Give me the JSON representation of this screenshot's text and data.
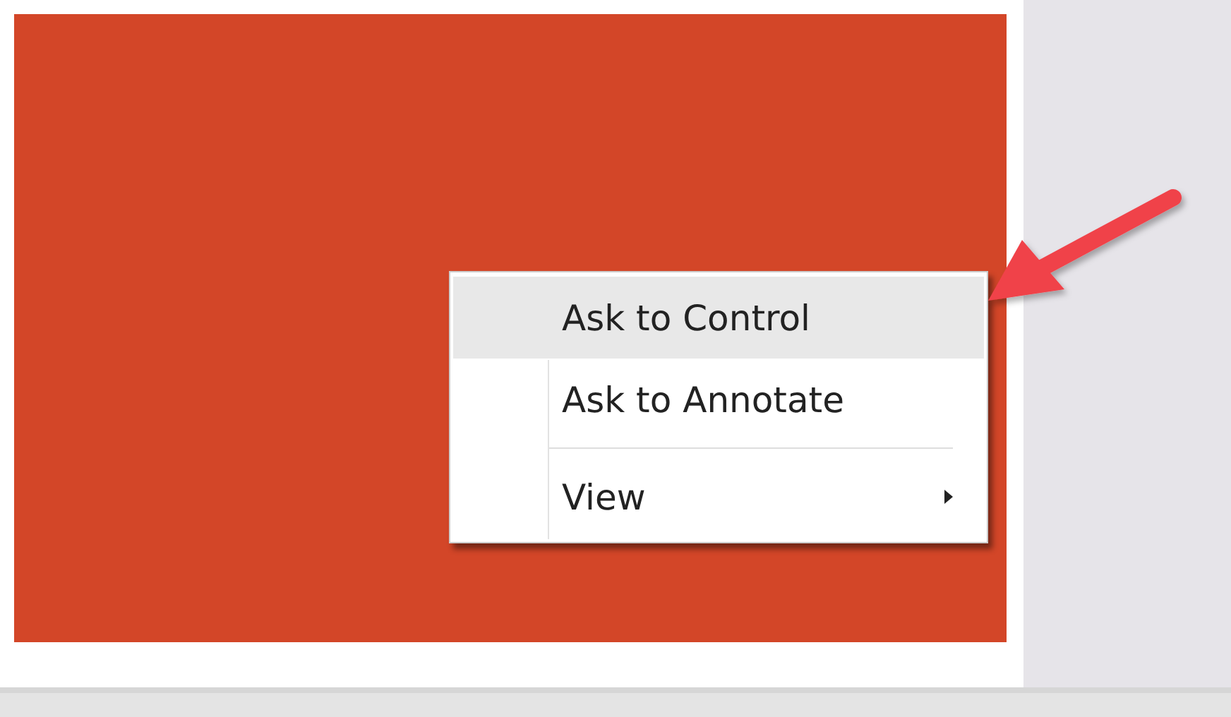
{
  "context_menu": {
    "items": [
      {
        "kind": "item",
        "label": "Ask to Control",
        "selected": true,
        "submenu": false
      },
      {
        "kind": "item",
        "label": "Ask to Annotate",
        "selected": false,
        "submenu": false
      },
      {
        "kind": "separator"
      },
      {
        "kind": "item",
        "label": "View",
        "selected": false,
        "submenu": true
      }
    ]
  }
}
